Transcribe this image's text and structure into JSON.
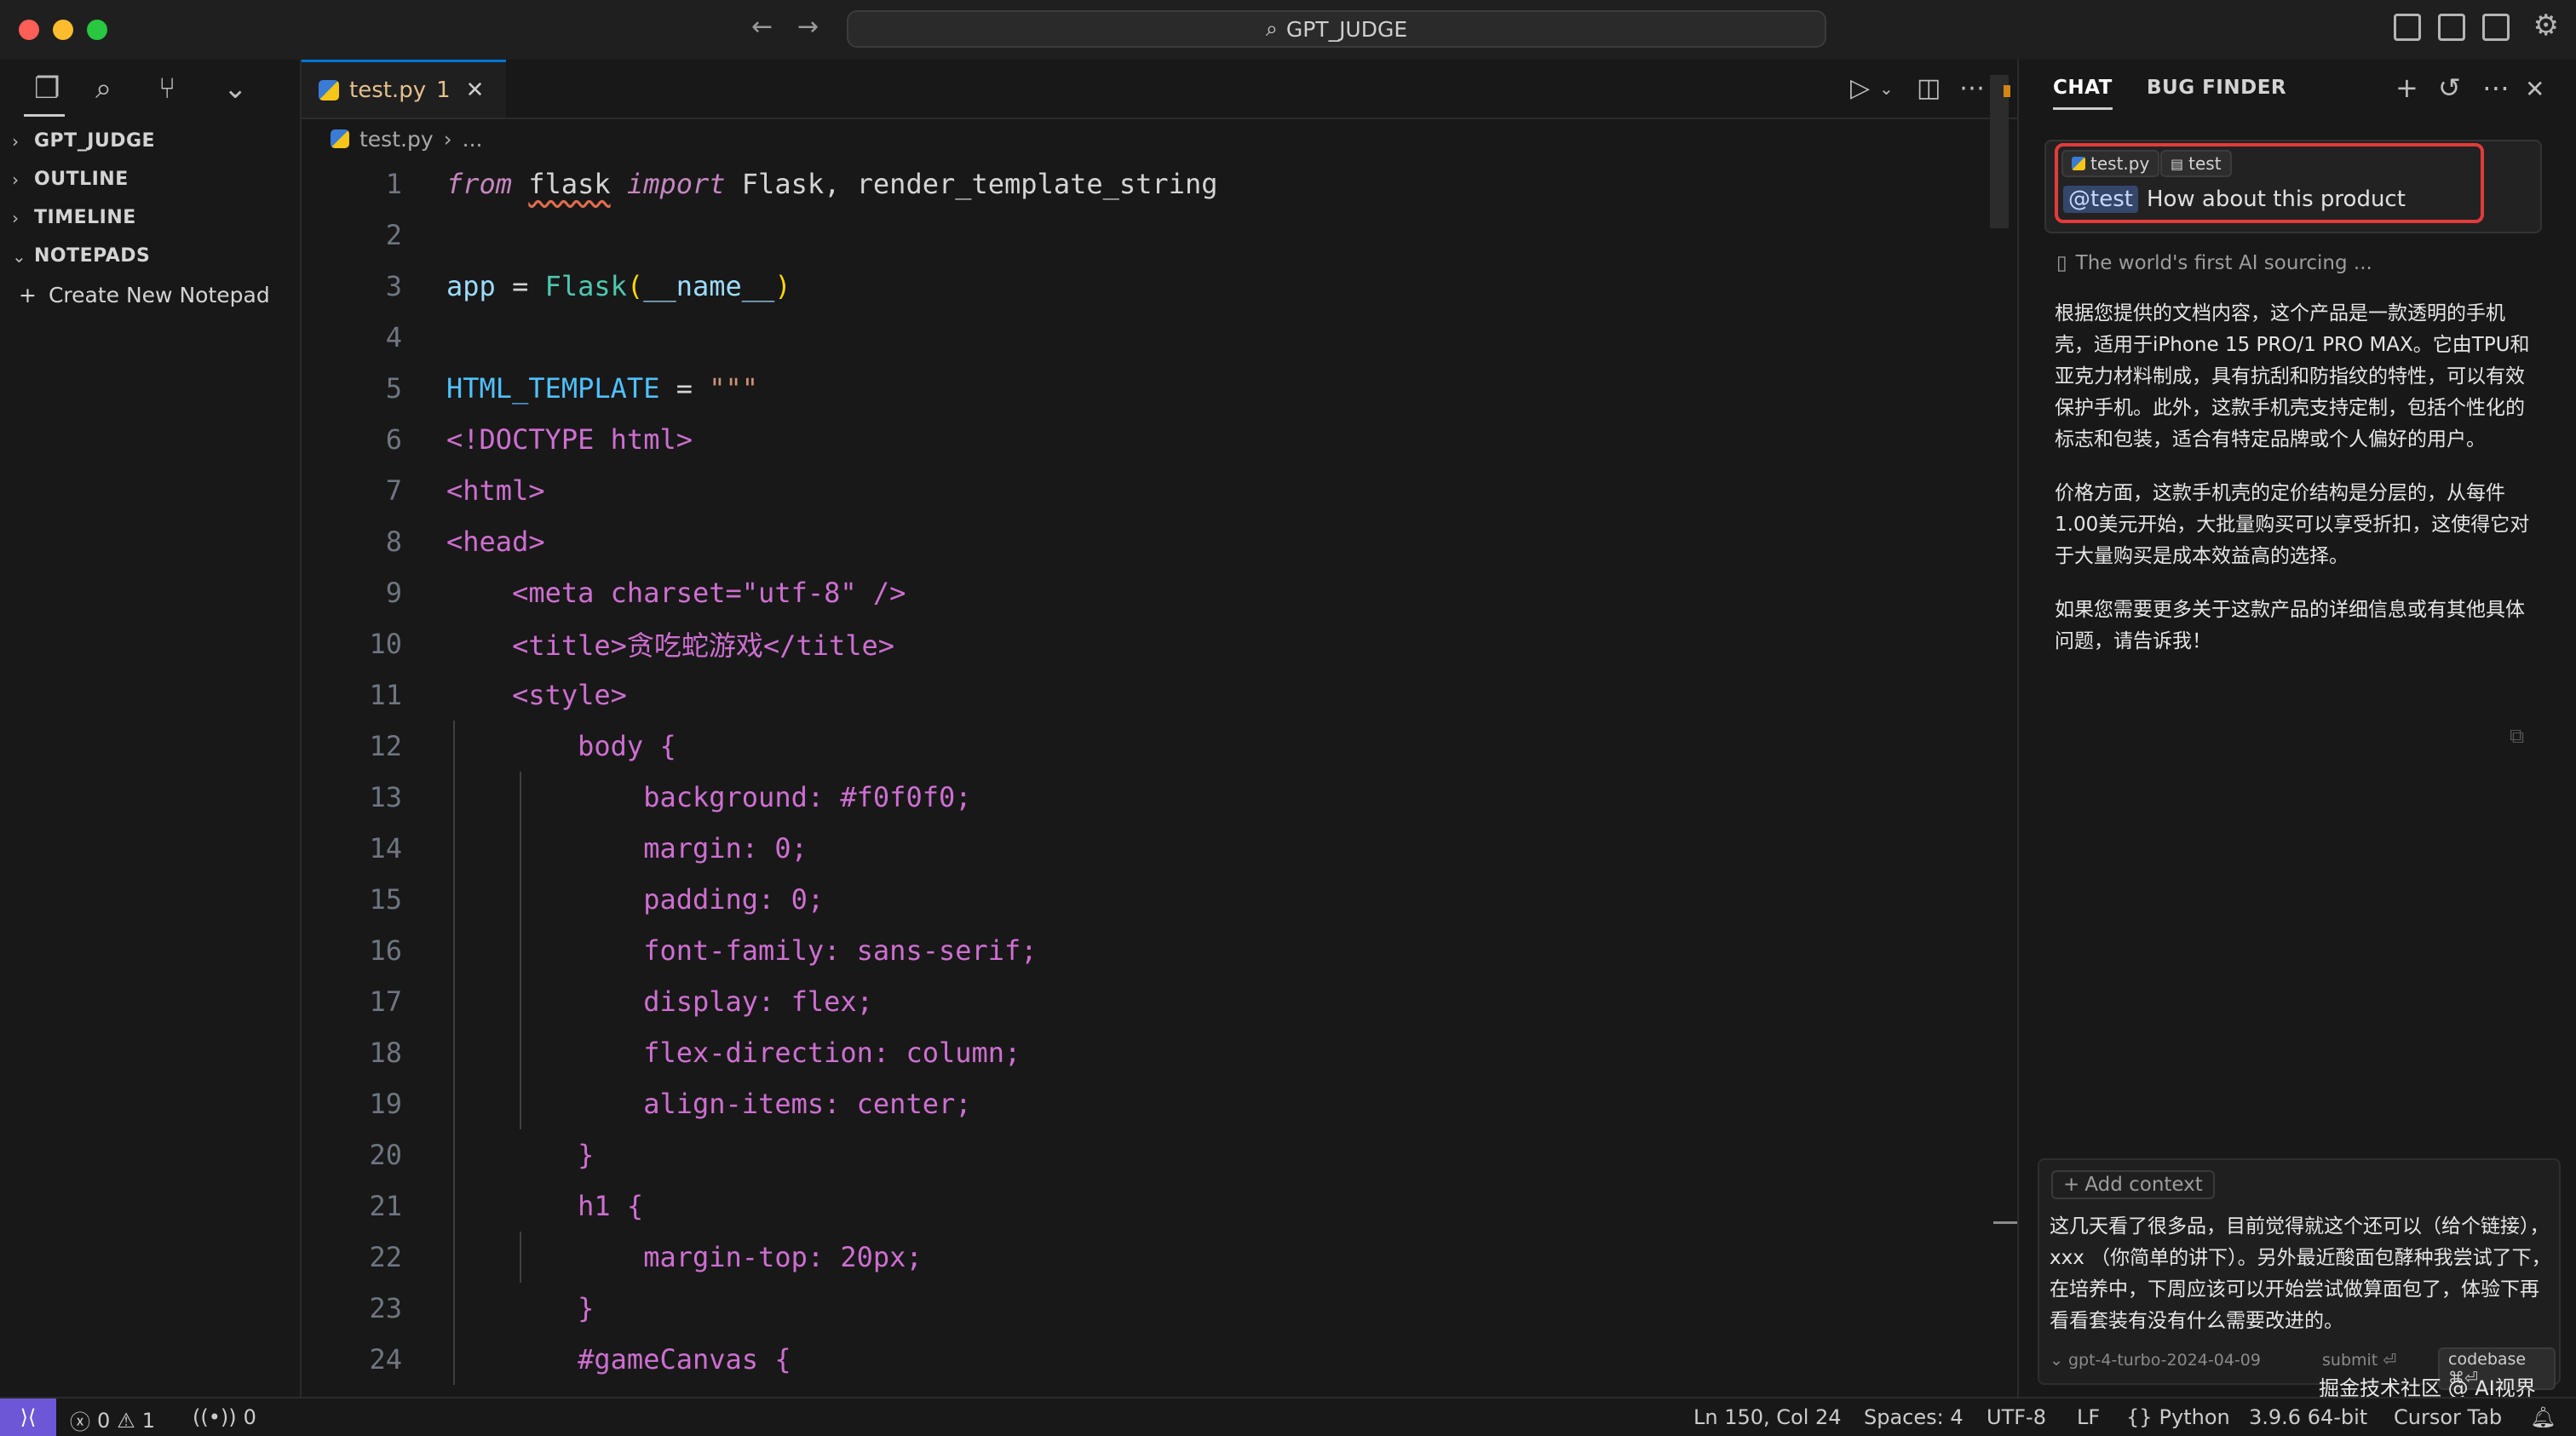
{
  "window": {
    "search_text": "GPT_JUDGE"
  },
  "sidebar": {
    "tree": [
      {
        "label": "GPT_JUDGE",
        "expanded": false
      },
      {
        "label": "OUTLINE",
        "expanded": false
      },
      {
        "label": "TIMELINE",
        "expanded": false
      },
      {
        "label": "NOTEPADS",
        "expanded": true
      }
    ],
    "create_notepad": "Create New Notepad"
  },
  "editor": {
    "tab": {
      "name": "test.py",
      "problems": "1"
    },
    "breadcrumb": {
      "file": "test.py",
      "rest": "..."
    },
    "lines": [
      {
        "n": "1",
        "t": "from flask import Flask, render_template_string"
      },
      {
        "n": "2",
        "t": ""
      },
      {
        "n": "3",
        "t": "app = Flask(__name__)"
      },
      {
        "n": "4",
        "t": ""
      },
      {
        "n": "5",
        "t": "HTML_TEMPLATE = \"\"\""
      },
      {
        "n": "6",
        "t": "<!DOCTYPE html>"
      },
      {
        "n": "7",
        "t": "<html>"
      },
      {
        "n": "8",
        "t": "<head>"
      },
      {
        "n": "9",
        "t": "    <meta charset=\"utf-8\" />"
      },
      {
        "n": "10",
        "t": "    <title>贪吃蛇游戏</title>"
      },
      {
        "n": "11",
        "t": "    <style>"
      },
      {
        "n": "12",
        "t": "        body {"
      },
      {
        "n": "13",
        "t": "            background: #f0f0f0;"
      },
      {
        "n": "14",
        "t": "            margin: 0;"
      },
      {
        "n": "15",
        "t": "            padding: 0;"
      },
      {
        "n": "16",
        "t": "            font-family: sans-serif;"
      },
      {
        "n": "17",
        "t": "            display: flex;"
      },
      {
        "n": "18",
        "t": "            flex-direction: column;"
      },
      {
        "n": "19",
        "t": "            align-items: center;"
      },
      {
        "n": "20",
        "t": "        }"
      },
      {
        "n": "21",
        "t": "        h1 {"
      },
      {
        "n": "22",
        "t": "            margin-top: 20px;"
      },
      {
        "n": "23",
        "t": "        }"
      },
      {
        "n": "24",
        "t": "        #gameCanvas {"
      }
    ]
  },
  "chat": {
    "tabs": [
      "CHAT",
      "BUG FINDER"
    ],
    "user_message": {
      "chips": [
        "test.py",
        "test"
      ],
      "mention": "@test",
      "text": "How about this product"
    },
    "doc_ref": "The world's first AI sourcing ...",
    "answer": [
      "根据您提供的文档内容，这个产品是一款透明的手机壳，适用于iPhone 15 PRO/1 PRO MAX。它由TPU和亚克力材料制成，具有抗刮和防指纹的特性，可以有效保护手机。此外，这款手机壳支持定制，包括个性化的标志和包装，适合有特定品牌或个人偏好的用户。",
      "价格方面，这款手机壳的定价结构是分层的，从每件1.00美元开始，大批量购买可以享受折扣，这使得它对于大量购买是成本效益高的选择。",
      "如果您需要更多关于这款产品的详细信息或有其他具体问题，请告诉我！"
    ],
    "composer": {
      "add_context": "Add context",
      "draft": "这几天看了很多品，目前觉得就这个还可以（给个链接），xxx （你简单的讲下）。另外最近酸面包酵种我尝试了下，在培养中，下周应该可以开始尝试做算面包了，体验下再看看套装有没有什么需要改进的。",
      "model": "gpt-4-turbo-2024-04-09",
      "submit": "submit ⏎",
      "codebase": "codebase ⌘⏎"
    }
  },
  "watermark": "掘金技术社区 @ AI视界",
  "status": {
    "errors": "0",
    "warnings": "1",
    "ports": "0",
    "position": "Ln 150, Col 24",
    "spaces": "Spaces: 4",
    "encoding": "UTF-8",
    "eol": "LF",
    "language": "Python",
    "interpreter": "3.9.6 64-bit",
    "cursor_tab": "Cursor Tab"
  }
}
